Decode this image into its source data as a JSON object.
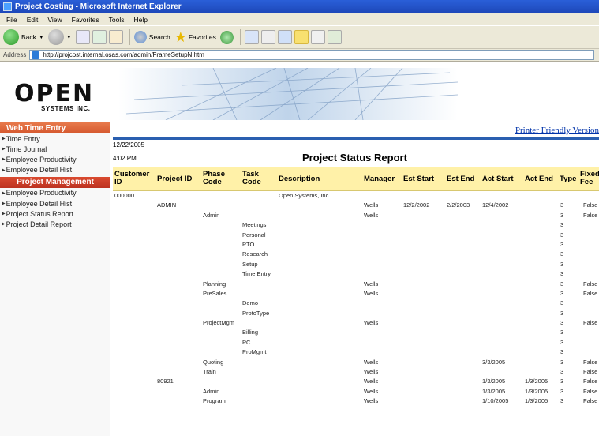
{
  "window": {
    "title": "Project Costing - Microsoft Internet Explorer"
  },
  "menu": [
    "File",
    "Edit",
    "View",
    "Favorites",
    "Tools",
    "Help"
  ],
  "toolbar": {
    "back": "Back",
    "search": "Search",
    "favorites": "Favorites"
  },
  "address": {
    "label": "Address",
    "url": "http://projcost.internal.osas.com/admin/FrameSetupN.htm"
  },
  "logo": {
    "top": "OPEN",
    "bottom": "SYSTEMS INC."
  },
  "sidebar": {
    "section1": "Web Time Entry",
    "items1": [
      "Time Entry",
      "Time Journal",
      "Employee Productivity",
      "Employee Detail Hist"
    ],
    "section2": "Project Management",
    "items2": [
      "Employee Productivity",
      "Employee Detail Hist",
      "Project Status Report",
      "Project Detail Report"
    ]
  },
  "report": {
    "printer_link": "Printer Friendly Version",
    "date": "12/22/2005",
    "time": "4:02 PM",
    "title": "Project Status Report",
    "columns": [
      "Customer ID",
      "Project ID",
      "Phase Code",
      "Task Code",
      "Description",
      "Manager",
      "Est Start",
      "Est End",
      "Act Start",
      "Act End",
      "Type",
      "Fixed Fee"
    ],
    "rows": [
      [
        "000000",
        "",
        "",
        "",
        "Open Systems, Inc.",
        "",
        "",
        "",
        "",
        "",
        "",
        ""
      ],
      [
        "",
        "ADMIN",
        "",
        "",
        "",
        "Wells",
        "12/2/2002",
        "2/2/2003",
        "12/4/2002",
        "",
        "3",
        "False"
      ],
      [
        "",
        "",
        "Admin",
        "",
        "",
        "Wells",
        "",
        "",
        "",
        "",
        "3",
        "False"
      ],
      [
        "",
        "",
        "",
        "Meetings",
        "",
        "",
        "",
        "",
        "",
        "",
        "3",
        ""
      ],
      [
        "",
        "",
        "",
        "Personal",
        "",
        "",
        "",
        "",
        "",
        "",
        "3",
        ""
      ],
      [
        "",
        "",
        "",
        "PTO",
        "",
        "",
        "",
        "",
        "",
        "",
        "3",
        ""
      ],
      [
        "",
        "",
        "",
        "Research",
        "",
        "",
        "",
        "",
        "",
        "",
        "3",
        ""
      ],
      [
        "",
        "",
        "",
        "Setup",
        "",
        "",
        "",
        "",
        "",
        "",
        "3",
        ""
      ],
      [
        "",
        "",
        "",
        "Time Entry",
        "",
        "",
        "",
        "",
        "",
        "",
        "3",
        ""
      ],
      [
        "",
        "",
        "Planning",
        "",
        "",
        "Wells",
        "",
        "",
        "",
        "",
        "3",
        "False"
      ],
      [
        "",
        "",
        "PreSales",
        "",
        "",
        "Wells",
        "",
        "",
        "",
        "",
        "3",
        "False"
      ],
      [
        "",
        "",
        "",
        "Demo",
        "",
        "",
        "",
        "",
        "",
        "",
        "3",
        ""
      ],
      [
        "",
        "",
        "",
        "ProtoType",
        "",
        "",
        "",
        "",
        "",
        "",
        "3",
        ""
      ],
      [
        "",
        "",
        "ProjectMgm",
        "",
        "",
        "Wells",
        "",
        "",
        "",
        "",
        "3",
        "False"
      ],
      [
        "",
        "",
        "",
        "Billing",
        "",
        "",
        "",
        "",
        "",
        "",
        "3",
        ""
      ],
      [
        "",
        "",
        "",
        "PC",
        "",
        "",
        "",
        "",
        "",
        "",
        "3",
        ""
      ],
      [
        "",
        "",
        "",
        "ProMgmt",
        "",
        "",
        "",
        "",
        "",
        "",
        "3",
        ""
      ],
      [
        "",
        "",
        "Quoting",
        "",
        "",
        "Wells",
        "",
        "",
        "3/3/2005",
        "",
        "3",
        "False"
      ],
      [
        "",
        "",
        "Train",
        "",
        "",
        "Wells",
        "",
        "",
        "",
        "",
        "3",
        "False"
      ],
      [
        "",
        "80921",
        "",
        "",
        "",
        "Wells",
        "",
        "",
        "1/3/2005",
        "1/3/2005",
        "3",
        "False"
      ],
      [
        "",
        "",
        "Admin",
        "",
        "",
        "Wells",
        "",
        "",
        "1/3/2005",
        "1/3/2005",
        "3",
        "False"
      ],
      [
        "",
        "",
        "Program",
        "",
        "",
        "Wells",
        "",
        "",
        "1/10/2005",
        "1/3/2005",
        "3",
        "False"
      ]
    ]
  }
}
